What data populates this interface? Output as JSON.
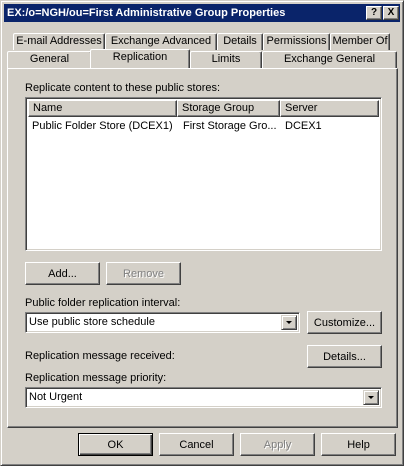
{
  "window": {
    "title": "EX:/o=NGH/ou=First Administrative Group Properties"
  },
  "title_buttons": {
    "help": "?",
    "close": "X"
  },
  "tabs_row1": [
    "E-mail Addresses",
    "Exchange Advanced",
    "Details",
    "Permissions",
    "Member Of"
  ],
  "tabs_row2": [
    "General",
    "Replication",
    "Limits",
    "Exchange General"
  ],
  "active_tab": "Replication",
  "replicate": {
    "label": "Replicate content to these public stores:",
    "columns": [
      "Name",
      "Storage Group",
      "Server"
    ],
    "rows": [
      [
        "Public Folder Store (DCEX1)",
        "First Storage Gro...",
        "DCEX1"
      ]
    ]
  },
  "buttons": {
    "add": "Add...",
    "remove": "Remove",
    "customize": "Customize...",
    "details": "Details...",
    "ok": "OK",
    "cancel": "Cancel",
    "apply": "Apply",
    "help": "Help"
  },
  "interval": {
    "label": "Public folder replication interval:",
    "value": "Use public store schedule"
  },
  "received": {
    "label": "Replication message received:"
  },
  "priority": {
    "label": "Replication message priority:",
    "value": "Not Urgent"
  },
  "colors": {
    "titlebar": "#0a246a",
    "face": "#d4d0c8"
  }
}
